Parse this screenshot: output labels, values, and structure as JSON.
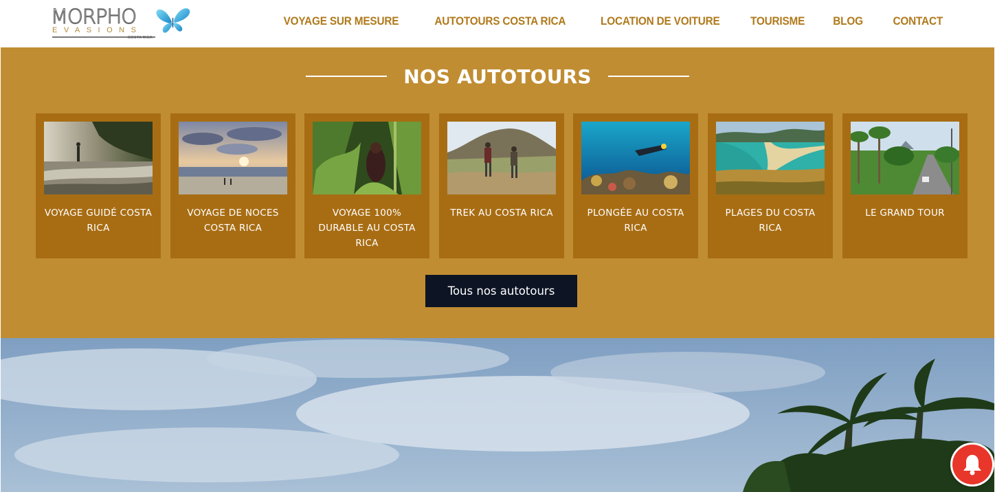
{
  "brand": {
    "name": "MORPHO",
    "subtitle": "EVASIONS",
    "tagline": "COSTA RICA"
  },
  "nav": {
    "items": [
      {
        "label": "VOYAGE SUR MESURE"
      },
      {
        "label": "AUTOTOURS COSTA RICA"
      },
      {
        "label": "LOCATION DE VOITURE"
      },
      {
        "label": "TOURISME"
      },
      {
        "label": "BLOG"
      },
      {
        "label": "CONTACT"
      }
    ]
  },
  "autotours": {
    "title": "NOS AUTOTOURS",
    "cards": [
      {
        "label": "VOYAGE GUIDÉ COSTA RICA"
      },
      {
        "label": "VOYAGE DE NOCES COSTA RICA"
      },
      {
        "label": "VOYAGE 100% DURABLE AU COSTA RICA"
      },
      {
        "label": "TREK AU COSTA RICA"
      },
      {
        "label": "PLONGÉE AU COSTA RICA"
      },
      {
        "label": "PLAGES DU COSTA RICA"
      },
      {
        "label": "LE GRAND TOUR"
      }
    ],
    "cta_label": "Tous nos autotours"
  },
  "icons": {
    "logo": "butterfly-icon",
    "notification": "bell-icon"
  },
  "colors": {
    "nav_text": "#b07a1c",
    "section_bg": "#c08d33",
    "card_bg": "#a86d13",
    "cta_bg": "#0d1424",
    "bell_bg": "#e8362a"
  }
}
